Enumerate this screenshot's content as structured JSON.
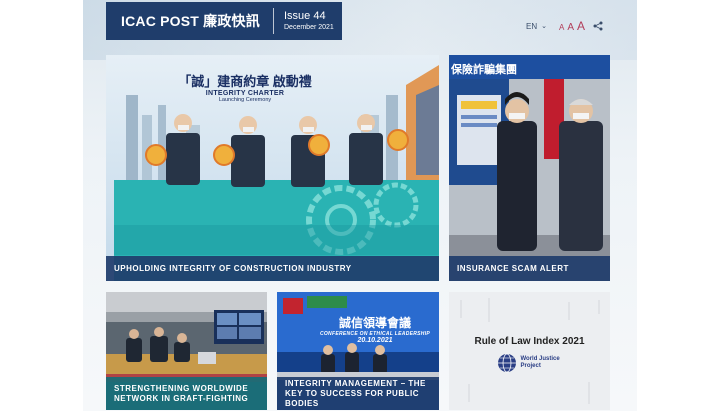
{
  "header": {
    "brand": "ICAC POST 廉政快訊",
    "issue": "Issue 44",
    "date": "December 2021"
  },
  "tools": {
    "language": "EN",
    "font_sizes": [
      "A",
      "A",
      "A"
    ]
  },
  "tiles": [
    {
      "caption": "UPHOLDING INTEGRITY OF CONSTRUCTION INDUSTRY",
      "plate_title": "「誠」建商約章 啟動禮",
      "plate_sub": "INTEGRITY CHARTER",
      "plate_sub2": "Launching Ceremony"
    },
    {
      "caption": "INSURANCE SCAM ALERT",
      "banner_text": "保險詐騙集團"
    },
    {
      "caption": "STRENGTHENING WORLDWIDE NETWORK IN GRAFT-FIGHTING"
    },
    {
      "caption": "INTEGRITY MANAGEMENT – THE KEY TO SUCCESS FOR PUBLIC BODIES",
      "plate_title": "誠信領導會議",
      "plate_sub": "CONFERENCE ON ETHICAL LEADERSHIP",
      "plate_date": "20.10.2021"
    },
    {
      "caption": "",
      "title": "Rule of Law Index 2021",
      "logo_text": "World Justice Project"
    }
  ],
  "colors": {
    "masthead": "#1f3d6b",
    "caption_blue": "#1f3d6b",
    "caption_teal": "#166e78",
    "font_size_accent": "#b23d5a"
  }
}
